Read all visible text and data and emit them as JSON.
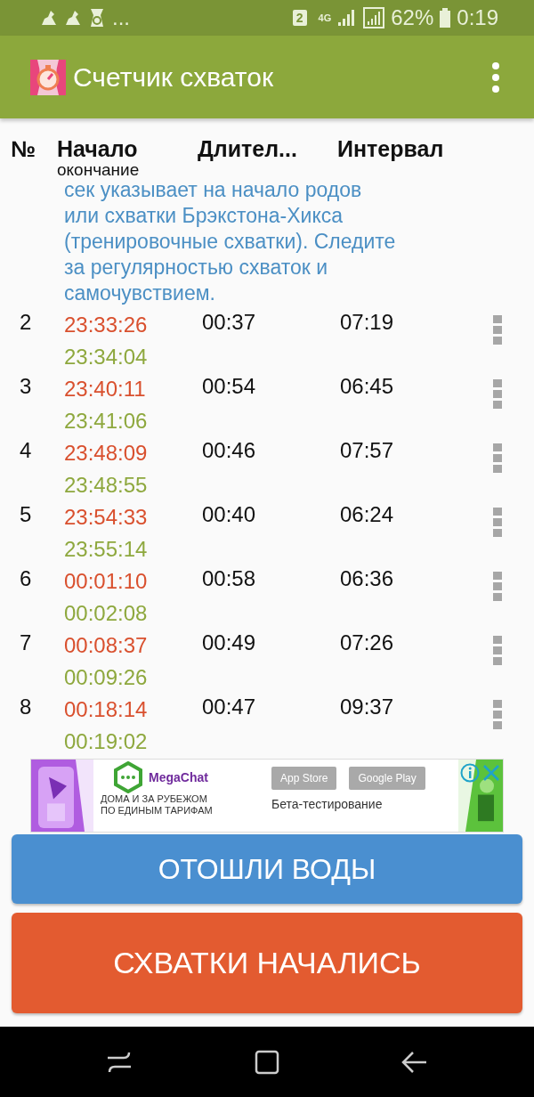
{
  "status_bar": {
    "overflow": "...",
    "sim": "2",
    "network": "4G",
    "battery": "62%",
    "time": "0:19"
  },
  "app_bar": {
    "title": "Счетчик схваток"
  },
  "table": {
    "columns": [
      {
        "title": "№"
      },
      {
        "title": "Начало",
        "subtitle": "окончание"
      },
      {
        "title": "Длител..."
      },
      {
        "title": "Интервал"
      }
    ],
    "note": [
      "сек указывает на начало родов",
      "или схватки Брэкстона-Хикса",
      "(тренировочные схватки). Следите",
      "за регулярностью схваток и",
      "самочувствием."
    ],
    "rows": [
      {
        "number": "2",
        "start": "23:33:26",
        "end": "23:34:04",
        "duration": "00:37",
        "interval": "07:19"
      },
      {
        "number": "3",
        "start": "23:40:11",
        "end": "23:41:06",
        "duration": "00:54",
        "interval": "06:45"
      },
      {
        "number": "4",
        "start": "23:48:09",
        "end": "23:48:55",
        "duration": "00:46",
        "interval": "07:57"
      },
      {
        "number": "5",
        "start": "23:54:33",
        "end": "23:55:14",
        "duration": "00:40",
        "interval": "06:24"
      },
      {
        "number": "6",
        "start": "00:01:10",
        "end": "00:02:08",
        "duration": "00:58",
        "interval": "06:36"
      },
      {
        "number": "7",
        "start": "00:08:37",
        "end": "00:09:26",
        "duration": "00:49",
        "interval": "07:26"
      },
      {
        "number": "8",
        "start": "00:18:14",
        "end": "00:19:02",
        "duration": "00:47",
        "interval": "09:37"
      }
    ]
  },
  "ad": {
    "brand": "MegaChat",
    "headline": [
      "ДОМА И ЗА РУБЕЖОМ",
      "ПО ЕДИНЫМ ТАРИФАМ"
    ],
    "stores": [
      "App Store",
      "Google Play"
    ],
    "caption": "Бета-тестирование"
  },
  "buttons": [
    {
      "label": "ОТОШЛИ ВОДЫ",
      "kind": "water"
    },
    {
      "label": "СХВАТКИ НАЧАЛИСЬ",
      "kind": "start"
    }
  ]
}
